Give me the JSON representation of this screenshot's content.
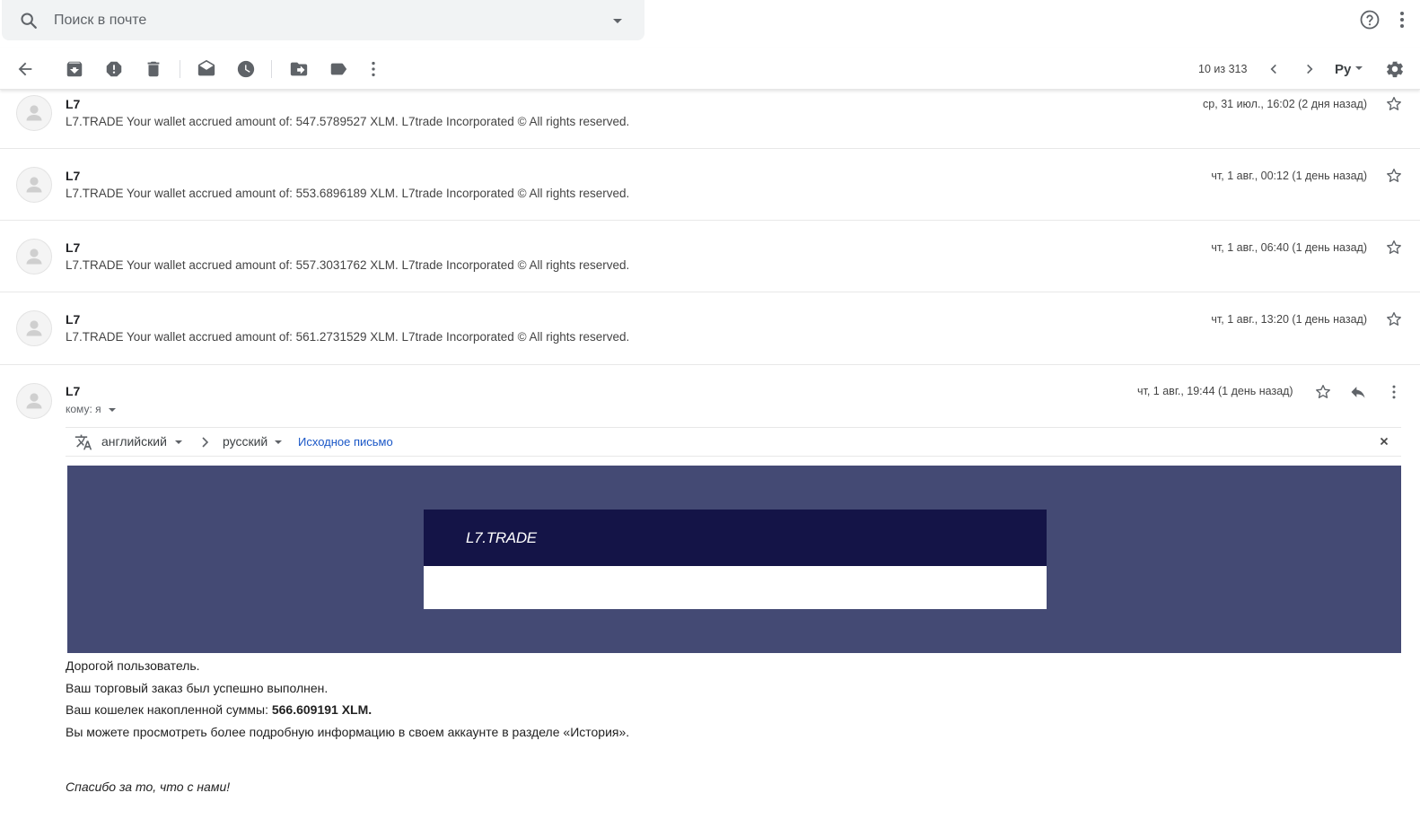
{
  "search": {
    "placeholder": "Поиск в почте"
  },
  "pager": {
    "text": "10 из 313"
  },
  "input_tool": {
    "label": "Ру"
  },
  "messages": [
    {
      "sender": "L7",
      "snippet": "L7.TRADE Your wallet accrued amount of: 547.5789527 XLM. L7trade Incorporated © All rights reserved.",
      "date": "ср, 31 июл., 16:02 (2 дня назад)"
    },
    {
      "sender": "L7",
      "snippet": "L7.TRADE Your wallet accrued amount of: 553.6896189 XLM. L7trade Incorporated © All rights reserved.",
      "date": "чт, 1 авг., 00:12 (1 день назад)"
    },
    {
      "sender": "L7",
      "snippet": "L7.TRADE Your wallet accrued amount of: 557.3031762 XLM. L7trade Incorporated © All rights reserved.",
      "date": "чт, 1 авг., 06:40 (1 день назад)"
    },
    {
      "sender": "L7",
      "snippet": "L7.TRADE Your wallet accrued amount of: 561.2731529 XLM. L7trade Incorporated © All rights reserved.",
      "date": "чт, 1 авг., 13:20 (1 день назад)"
    }
  ],
  "open_message": {
    "sender": "L7",
    "to": "кому: я",
    "date": "чт, 1 авг., 19:44 (1 день назад)"
  },
  "translate": {
    "from_lang": "английский",
    "to_lang": "русский",
    "original_link": "Исходное письмо"
  },
  "email_body": {
    "brand": "L7.TRADE",
    "greeting": "Дорогой пользователь.",
    "line1": "Ваш торговый заказ был успешно выполнен.",
    "line2_prefix": "Ваш кошелек накопленной суммы: ",
    "line2_amount": "566.609191 XLM.",
    "line3": "Вы можете просмотреть более подробную информацию в своем аккаунте в разделе «История».",
    "signoff": "Спасибо за то, что с нами!"
  },
  "colors": {
    "banner_bg": "#444a74",
    "banner_header": "#141447",
    "link": "#1a57c7"
  }
}
